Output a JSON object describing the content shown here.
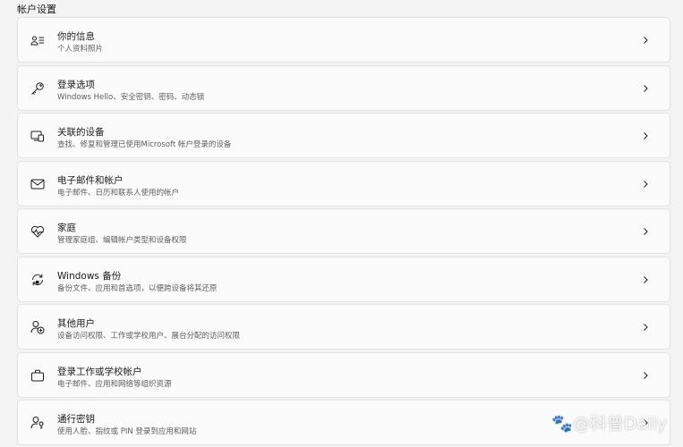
{
  "header": {
    "section_title": "帐户设置"
  },
  "items": [
    {
      "icon": "person-info-icon",
      "title": "你的信息",
      "description": "个人资料照片"
    },
    {
      "icon": "key-icon",
      "title": "登录选项",
      "description": "Windows Hello、安全密钥、密码、动态锁"
    },
    {
      "icon": "linked-devices-icon",
      "title": "关联的设备",
      "description": "查找、修复和管理已使用Microsoft 帐户登录的设备"
    },
    {
      "icon": "mail-icon",
      "title": "电子邮件和帐户",
      "description": "电子邮件、日历和联系人使用的帐户"
    },
    {
      "icon": "family-heart-icon",
      "title": "家庭",
      "description": "管理家庭组、编辑帐户类型和设备权限"
    },
    {
      "icon": "windows-backup-icon",
      "title": "Windows 备份",
      "description": "备份文件、应用和首选项，以便跨设备将其还原"
    },
    {
      "icon": "add-user-icon",
      "title": "其他用户",
      "description": "设备访问权限、工作或学校用户、展台分配的访问权限"
    },
    {
      "icon": "briefcase-icon",
      "title": "登录工作或学校帐户",
      "description": "电子邮件、应用和网络等组织资源"
    },
    {
      "icon": "passkey-icon",
      "title": "通行密钥",
      "description": "使用人脸、指纹或 PIN 登录到应用和网站"
    }
  ],
  "watermark": "🐾@科普Daily"
}
